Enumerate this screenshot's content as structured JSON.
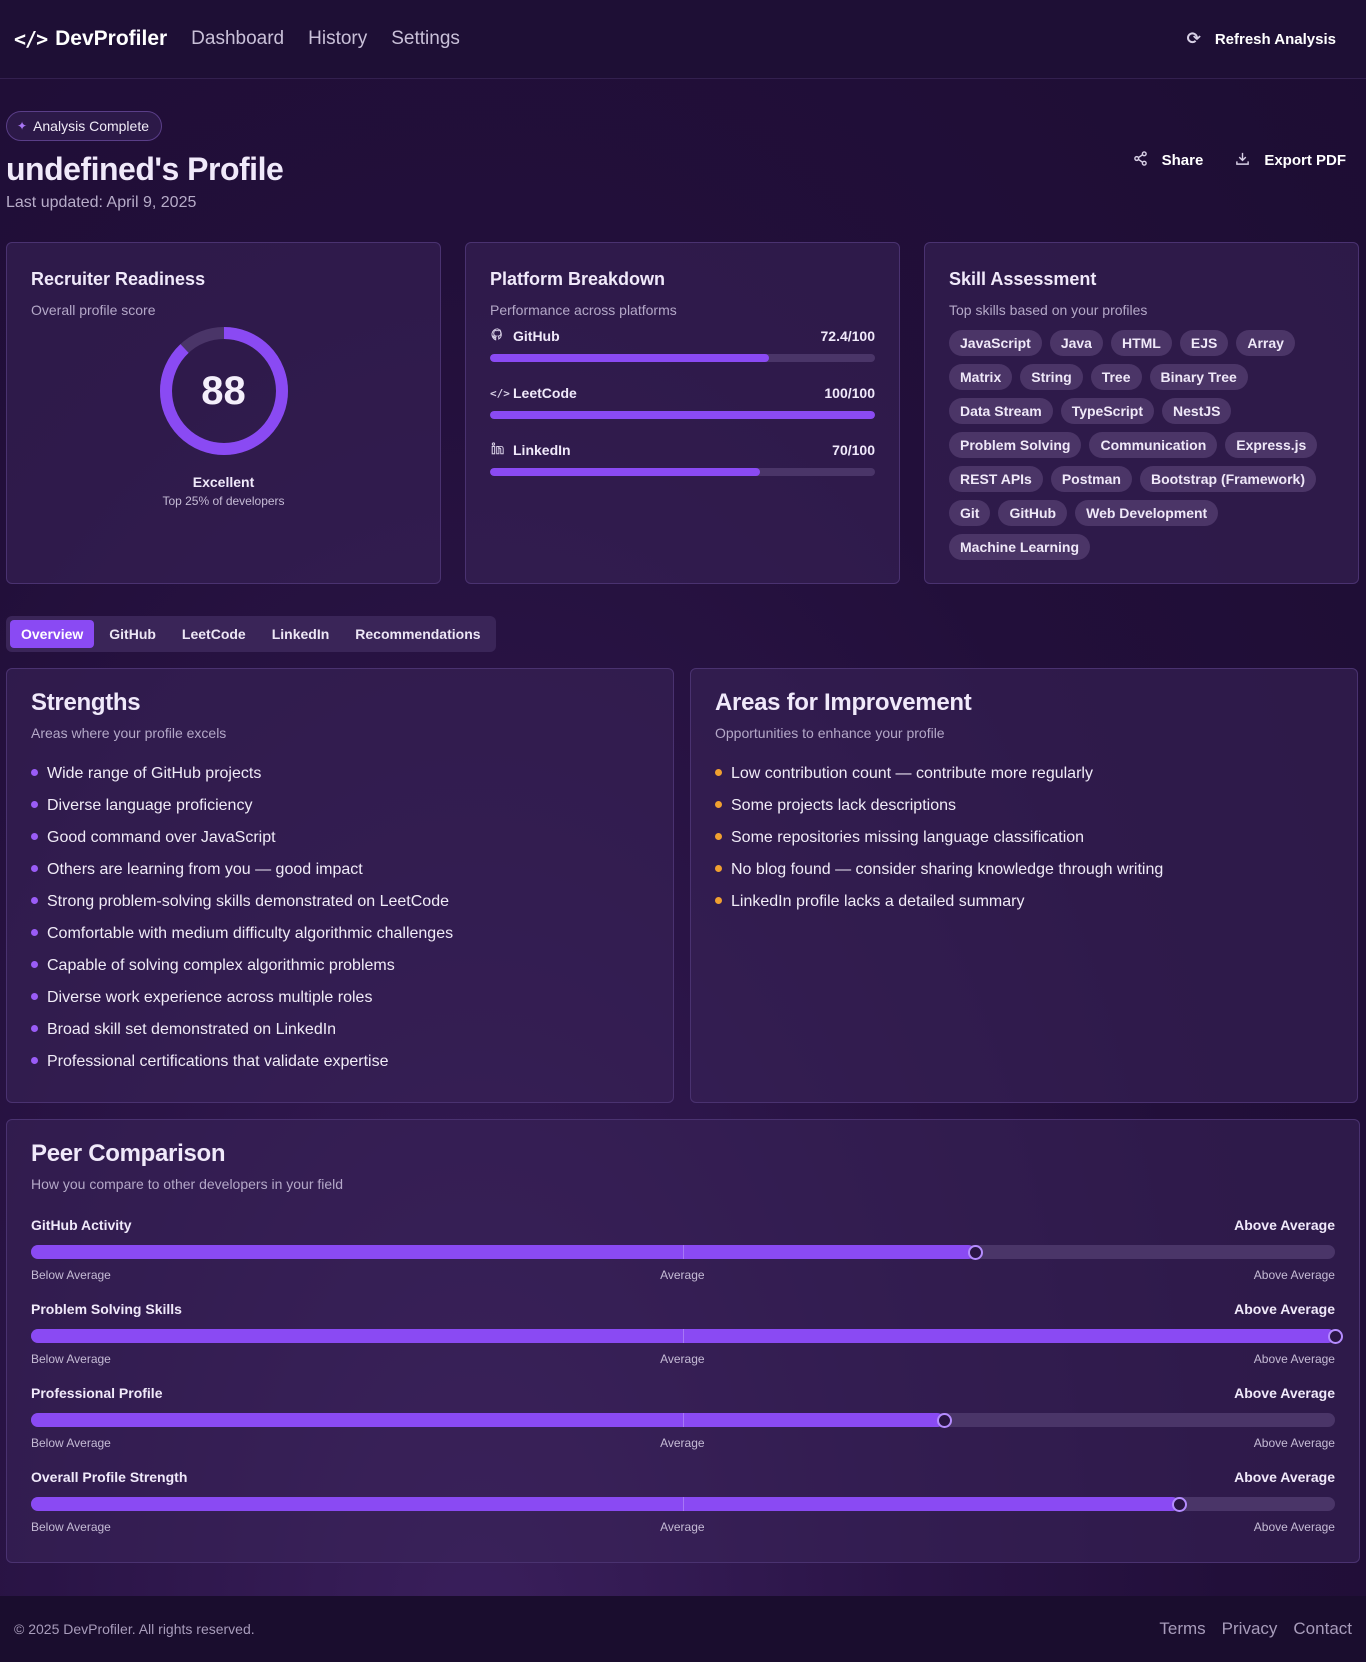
{
  "nav": {
    "brand": "DevProfiler",
    "logo_icon": "code-icon",
    "links": [
      "Dashboard",
      "History",
      "Settings"
    ],
    "refresh_label": "Refresh Analysis"
  },
  "header": {
    "badge": "Analysis Complete",
    "title": "undefined's Profile",
    "updated": "Last updated: April 9, 2025",
    "share_label": "Share",
    "export_label": "Export PDF"
  },
  "readiness": {
    "title": "Recruiter Readiness",
    "subtitle": "Overall profile score",
    "score": 88,
    "label": "Excellent",
    "sublabel": "Top 25% of developers"
  },
  "platforms": {
    "title": "Platform Breakdown",
    "subtitle": "Performance across platforms",
    "items": [
      {
        "name": "GitHub",
        "score_text": "72.4/100",
        "value": 72.4,
        "icon": "github-icon"
      },
      {
        "name": "LeetCode",
        "score_text": "100/100",
        "value": 100,
        "icon": "code-icon"
      },
      {
        "name": "LinkedIn",
        "score_text": "70/100",
        "value": 70,
        "icon": "linkedin-icon"
      }
    ]
  },
  "skills": {
    "title": "Skill Assessment",
    "subtitle": "Top skills based on your profiles",
    "items": [
      "JavaScript",
      "Java",
      "HTML",
      "EJS",
      "Array",
      "Matrix",
      "String",
      "Tree",
      "Binary Tree",
      "Data Stream",
      "TypeScript",
      "NestJS",
      "Problem Solving",
      "Communication",
      "Express.js",
      "REST APIs",
      "Postman",
      "Bootstrap (Framework)",
      "Git",
      "GitHub",
      "Web Development",
      "Machine Learning"
    ]
  },
  "tabs": {
    "items": [
      "Overview",
      "GitHub",
      "LeetCode",
      "LinkedIn",
      "Recommendations"
    ],
    "active": "Overview"
  },
  "strengths": {
    "title": "Strengths",
    "subtitle": "Areas where your profile excels",
    "items": [
      "Wide range of GitHub projects",
      "Diverse language proficiency",
      "Good command over JavaScript",
      "Others are learning from you — good impact",
      "Strong problem-solving skills demonstrated on LeetCode",
      "Comfortable with medium difficulty algorithmic challenges",
      "Capable of solving complex algorithmic problems",
      "Diverse work experience across multiple roles",
      "Broad skill set demonstrated on LinkedIn",
      "Professional certifications that validate expertise"
    ]
  },
  "improvements": {
    "title": "Areas for Improvement",
    "subtitle": "Opportunities to enhance your profile",
    "items": [
      "Low contribution count — contribute more regularly",
      "Some projects lack descriptions",
      "Some repositories missing language classification",
      "No blog found — consider sharing knowledge through writing",
      "LinkedIn profile lacks a detailed summary"
    ]
  },
  "peer": {
    "title": "Peer Comparison",
    "subtitle": "How you compare to other developers in your field",
    "scale": [
      "Below Average",
      "Average",
      "Above Average"
    ],
    "items": [
      {
        "name": "GitHub Activity",
        "rating": "Above Average",
        "percent": 72.4
      },
      {
        "name": "Problem Solving Skills",
        "rating": "Above Average",
        "percent": 100
      },
      {
        "name": "Professional Profile",
        "rating": "Above Average",
        "percent": 70
      },
      {
        "name": "Overall Profile Strength",
        "rating": "Above Average",
        "percent": 88
      }
    ]
  },
  "footer": {
    "copyright": "© 2025 DevProfiler. All rights reserved.",
    "links": [
      "Terms",
      "Privacy",
      "Contact"
    ]
  },
  "colors": {
    "accent": "#8a4af3",
    "background": "#220f3a",
    "improvement_dot": "#f0a030"
  }
}
